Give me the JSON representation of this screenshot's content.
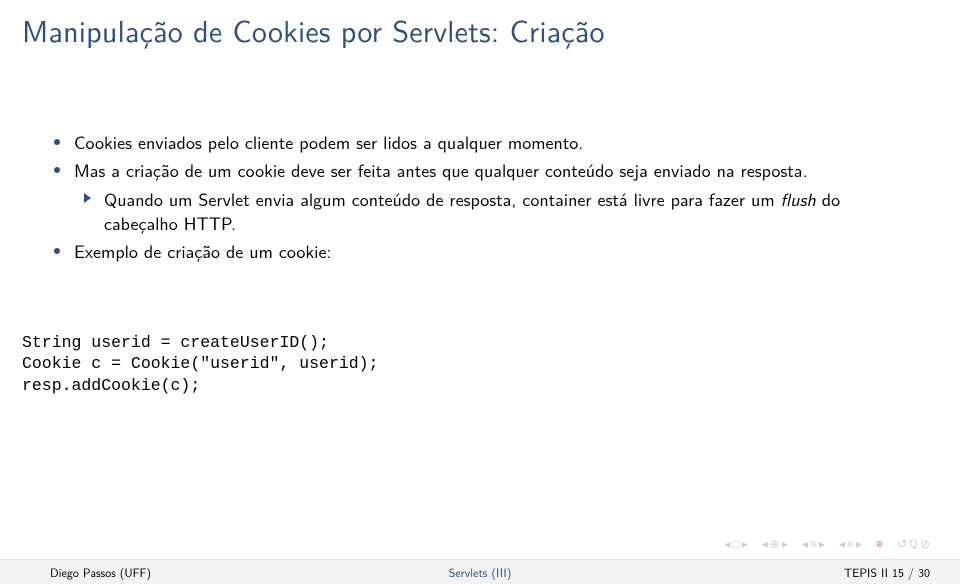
{
  "title": "Manipulação de Cookies por Servlets: Criação",
  "items": [
    {
      "text": "Cookies enviados pelo cliente podem ser lidos a qualquer momento."
    },
    {
      "text": "Mas a criação de um cookie deve ser feita antes que qualquer conteúdo seja enviado na resposta."
    },
    {
      "text_pre": "Quando um Servlet envia algum conteúdo de resposta, container está livre para fazer um ",
      "text_em": "flush",
      "text_post": " do cabeçalho HTTP.",
      "sub": true
    },
    {
      "text": "Exemplo de criação de um cookie:"
    }
  ],
  "code": {
    "line1": "String userid = createUserID();",
    "line2": "Cookie c = Cookie(\"userid\", userid);",
    "line3": "resp.addCookie(c);"
  },
  "nav": {
    "back_slide": "◂ □ ▸",
    "back_sub": "◂ ⊘ ▸",
    "back_sec": "◂ ≡ ▸",
    "fwd_sec": "◂ ≡ ▸",
    "eq": "≡",
    "loop": "↻ Q ⊘"
  },
  "footer": {
    "left": "Diego Passos (UFF)",
    "center": "Servlets (III)",
    "right": "TEPIS II        15 / 30"
  }
}
